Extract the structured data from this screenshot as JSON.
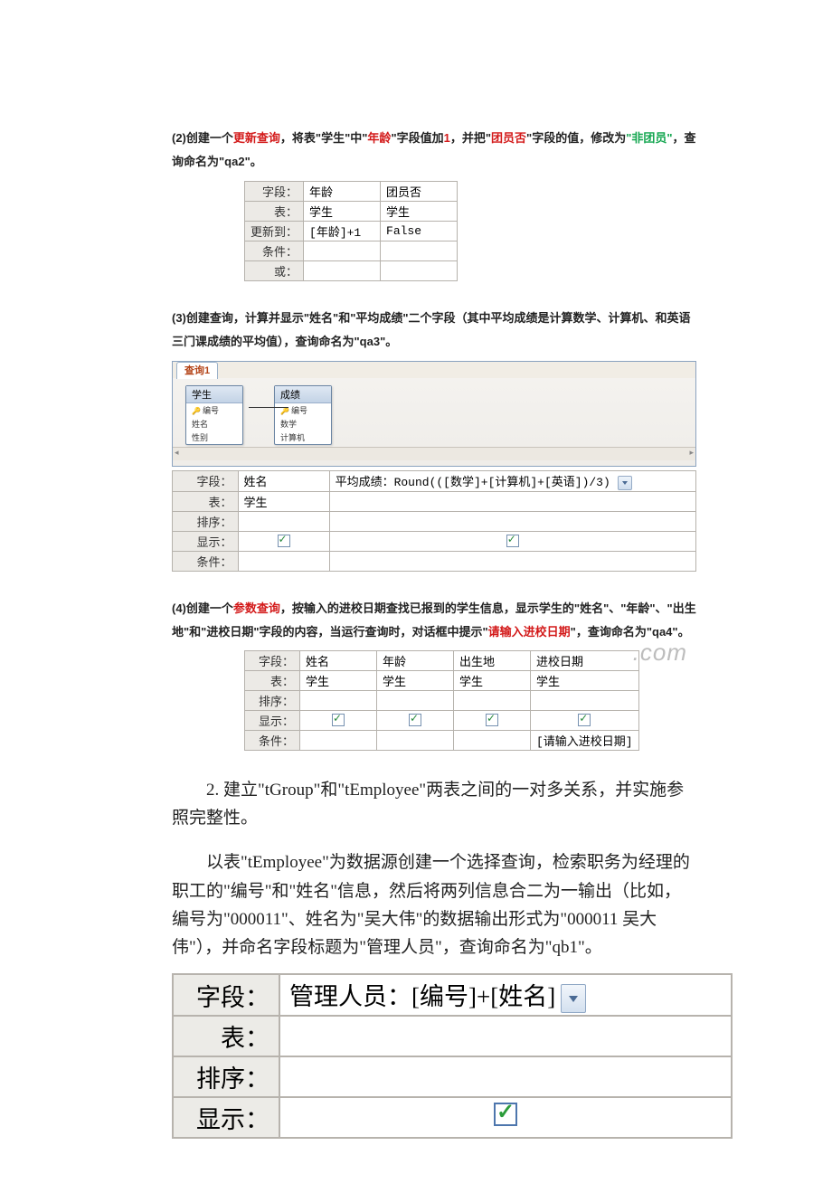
{
  "q2": {
    "text_parts": {
      "pre": "(2)创建一个",
      "red1": "更新查询",
      "mid1": "，将表\"",
      "t_student": "学生",
      "mid2": "\"中\"",
      "red2": "年龄",
      "mid3": "\"字段值加",
      "red3": "1",
      "mid4": "，并把\"",
      "red4": "团员否",
      "mid5": "\"字段的值，修改为",
      "green": "\"非团员\"",
      "tail": "，查询命名为\"qa2\"。"
    },
    "rows": [
      "字段：",
      "表：",
      "更新到：",
      "条件：",
      "或："
    ],
    "col1": [
      "年龄",
      "学生",
      "[年龄]+1",
      "",
      ""
    ],
    "col2": [
      "团员否",
      "学生",
      "False",
      "",
      ""
    ]
  },
  "q3": {
    "text": "(3)创建查询，计算并显示\"姓名\"和\"平均成绩\"二个字段（其中平均成绩是计算数学、计算机、和英语三门课成绩的平均值），查询命名为\"qa3\"。",
    "tab": "查询1",
    "box1": {
      "title": "学生",
      "fields": [
        "编号",
        "姓名",
        "性别"
      ],
      "keyidx": 0
    },
    "box2": {
      "title": "成绩",
      "fields": [
        "编号",
        "数学",
        "计算机"
      ],
      "keyidx": 0
    },
    "rows": [
      "字段：",
      "表：",
      "排序：",
      "显示：",
      "条件："
    ],
    "col1": [
      "姓名",
      "学生",
      "",
      "[x]",
      ""
    ],
    "col2_label": "平均成绩：Round(([数学]+[计算机]+[英语])/3)",
    "col2_show": "[x]"
  },
  "q4": {
    "text_parts": {
      "pre": "(4)创建一个",
      "red1": "参数查询",
      "mid1": "，按输入的进校日期查找已报到的学生信息，显示学生的\"姓名\"、\"年龄\"、\"出生地\"和\"进校日期\"字段的内容，当运行查询时，对话框中提示\"",
      "red2": "请输入进校日期",
      "tail": "\"，查询命名为\"qa4\"。"
    },
    "watermark": ".com",
    "rows": [
      "字段：",
      "表：",
      "排序：",
      "显示：",
      "条件："
    ],
    "headers": [
      "姓名",
      "年龄",
      "出生地",
      "进校日期"
    ],
    "tables": [
      "学生",
      "学生",
      "学生",
      "学生"
    ],
    "criteria": [
      "",
      "",
      "",
      "[请输入进校日期]"
    ]
  },
  "para1": "2. 建立\"tGroup\"和\"tEmployee\"两表之间的一对多关系，并实施参照完整性。",
  "para2": "以表\"tEmployee\"为数据源创建一个选择查询，检索职务为经理的职工的\"编号\"和\"姓名\"信息，然后将两列信息合二为一输出（比如，编号为\"000011\"、姓名为\"吴大伟\"的数据输出形式为\"000011 吴大伟\"），并命名字段标题为\"管理人员\"，查询命名为\"qb1\"。",
  "big": {
    "rows": [
      "字段：",
      "表：",
      "排序：",
      "显示："
    ],
    "expr": "管理人员：[编号]+[姓名]"
  }
}
